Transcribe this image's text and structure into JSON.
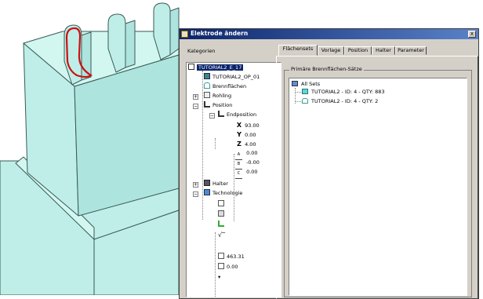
{
  "dialog": {
    "title": "Elektrode ändern",
    "close_label": "x",
    "categories_label": "Kategorien"
  },
  "tree": {
    "root": "TUTORIAL2_E_17",
    "op": "TUTORIAL2_OP_01",
    "burn_surfaces": "Brennflächen",
    "blank": "Rohling",
    "position": "Position",
    "end_position": "Endposition",
    "coords": [
      {
        "axis": "X",
        "value": "93.00"
      },
      {
        "axis": "Y",
        "value": "0.00"
      },
      {
        "axis": "Z",
        "value": "4.00"
      },
      {
        "axis": "A",
        "value": "0.00"
      },
      {
        "axis": "B",
        "value": "-0.00"
      },
      {
        "axis": "C",
        "value": "0.00"
      }
    ],
    "holder": "Halter",
    "technology": "Technologie",
    "tech_value_1": "463.31",
    "tech_value_2": "0.00"
  },
  "tabs": [
    "Flächensets",
    "Vorlage",
    "Position",
    "Halter",
    "Parameter"
  ],
  "active_tab": "Flächensets",
  "sets_panel": {
    "group_label": "Primäre Brennflächen-Sätze",
    "all_sets": "All Sets",
    "items": [
      "TUTORIAL2 - ID: 4 - QTY: 883",
      "TUTORIAL2 - ID: 4 - QTY: 2"
    ]
  },
  "colors": {
    "model_fill": "#bfeee8",
    "model_edge": "#3a5a56",
    "highlight_edge": "#cc1010",
    "title_bar": "#0a246a",
    "dialog_bg": "#d4d0c8"
  }
}
